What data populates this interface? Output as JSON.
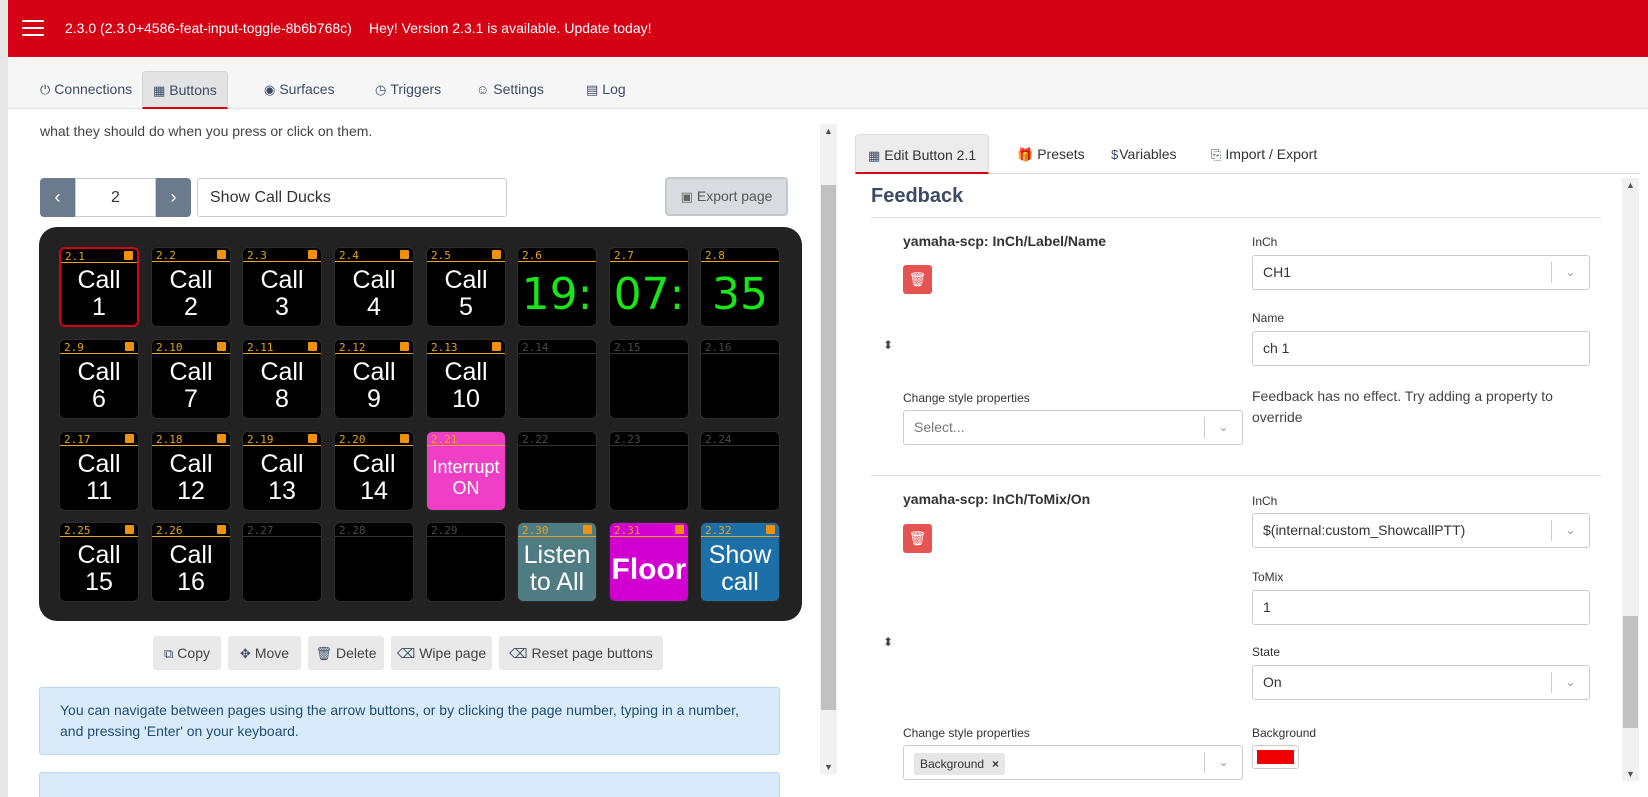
{
  "header": {
    "version": "2.3.0 (2.3.0+4586-feat-input-toggle-8b6b768c)",
    "update_notice": "Hey! Version 2.3.1 is available. Update today!"
  },
  "nav": {
    "tabs": [
      {
        "label": "Connections",
        "icon": "plug-icon"
      },
      {
        "label": "Buttons",
        "icon": "calculator-icon",
        "active": true
      },
      {
        "label": "Surfaces",
        "icon": "gamepad-icon"
      },
      {
        "label": "Triggers",
        "icon": "clock-icon"
      },
      {
        "label": "Settings",
        "icon": "users-cog-icon"
      },
      {
        "label": "Log",
        "icon": "clipboard-icon"
      }
    ]
  },
  "buttons_panel": {
    "intro_text": "what they should do when you press or click on them.",
    "page_number": "2",
    "page_name": "Show Call Ducks",
    "export_label": "Export page",
    "keys": [
      {
        "id": "2.1",
        "text": "Call\n1",
        "flag": true,
        "selected": true
      },
      {
        "id": "2.2",
        "text": "Call\n2",
        "flag": true
      },
      {
        "id": "2.3",
        "text": "Call\n3",
        "flag": true
      },
      {
        "id": "2.4",
        "text": "Call\n4",
        "flag": true
      },
      {
        "id": "2.5",
        "text": "Call\n5",
        "flag": true
      },
      {
        "id": "2.6",
        "text": "19:",
        "clock": true
      },
      {
        "id": "2.7",
        "text": "07:",
        "clock": true
      },
      {
        "id": "2.8",
        "text": "35",
        "clock": true
      },
      {
        "id": "2.9",
        "text": "Call\n6",
        "flag": true
      },
      {
        "id": "2.10",
        "text": "Call\n7",
        "flag": true
      },
      {
        "id": "2.11",
        "text": "Call\n8",
        "flag": true
      },
      {
        "id": "2.12",
        "text": "Call\n9",
        "flag": true
      },
      {
        "id": "2.13",
        "text": "Call\n10",
        "flag": true
      },
      {
        "id": "2.14",
        "text": "",
        "empty": true
      },
      {
        "id": "2.15",
        "text": "",
        "empty": true
      },
      {
        "id": "2.16",
        "text": "",
        "empty": true
      },
      {
        "id": "2.17",
        "text": "Call\n11",
        "flag": true
      },
      {
        "id": "2.18",
        "text": "Call\n12",
        "flag": true
      },
      {
        "id": "2.19",
        "text": "Call\n13",
        "flag": true
      },
      {
        "id": "2.20",
        "text": "Call\n14",
        "flag": true
      },
      {
        "id": "2.21",
        "text": "Interrupt\nON",
        "bg": "#ee3fc6",
        "small": true
      },
      {
        "id": "2.22",
        "text": "",
        "empty": true
      },
      {
        "id": "2.23",
        "text": "",
        "empty": true
      },
      {
        "id": "2.24",
        "text": "",
        "empty": true
      },
      {
        "id": "2.25",
        "text": "Call\n15",
        "flag": true
      },
      {
        "id": "2.26",
        "text": "Call\n16",
        "flag": true
      },
      {
        "id": "2.27",
        "text": "",
        "empty": true
      },
      {
        "id": "2.28",
        "text": "",
        "empty": true
      },
      {
        "id": "2.29",
        "text": "",
        "empty": true
      },
      {
        "id": "2.30",
        "text": "Listen\nto All",
        "flag": true,
        "bg": "#4f7b83"
      },
      {
        "id": "2.31",
        "text": "Floor",
        "flag": true,
        "bg": "#d100d1",
        "big": true
      },
      {
        "id": "2.32",
        "text": "Show\ncall",
        "flag": true,
        "bg": "#1d6fa8"
      }
    ],
    "tools": {
      "copy": "Copy",
      "move": "Move",
      "delete": "Delete",
      "wipe": "Wipe page",
      "reset": "Reset page buttons"
    },
    "info_text": "You can navigate between pages using the arrow buttons, or by clicking the page number, typing in a number, and pressing 'Enter' on your keyboard."
  },
  "editor": {
    "tabs": [
      {
        "label": "Edit Button 2.1",
        "icon": "calculator-icon",
        "active": true
      },
      {
        "label": "Presets",
        "icon": "gift-icon"
      },
      {
        "label": "Variables",
        "icon": "dollar-icon"
      },
      {
        "label": "Import / Export",
        "icon": "file-import-icon"
      }
    ],
    "section_title": "Feedback",
    "feedback1": {
      "name": "yamaha-scp: InCh/Label/Name",
      "inch_label": "InCh",
      "inch_value": "CH1",
      "name_label": "Name",
      "name_value": "ch 1",
      "style_label": "Change style properties",
      "style_placeholder": "Select...",
      "note": "Feedback has no effect. Try adding a property to override"
    },
    "feedback2": {
      "name": "yamaha-scp: InCh/ToMix/On",
      "inch_label": "InCh",
      "inch_value": "$(internal:custom_ShowcallPTT)",
      "tomix_label": "ToMix",
      "tomix_value": "1",
      "state_label": "State",
      "state_value": "On",
      "style_label": "Change style properties",
      "style_tag": "Background",
      "bg_label": "Background",
      "bg_color": "#ee0000"
    }
  }
}
